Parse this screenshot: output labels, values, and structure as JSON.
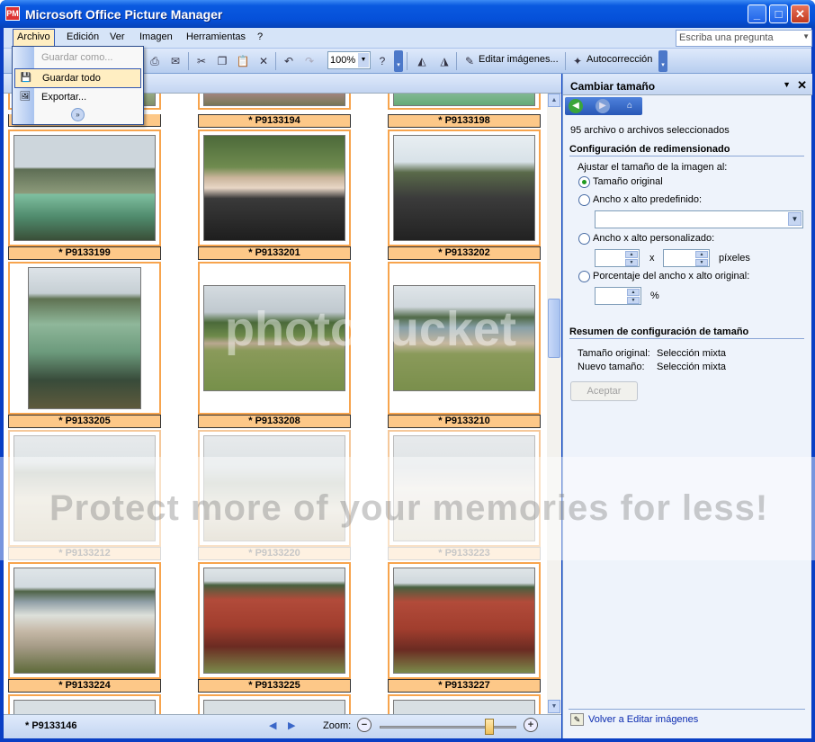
{
  "window": {
    "title": "Microsoft Office Picture Manager",
    "minimize": "_",
    "maximize": "□",
    "close": "✕",
    "app_icon": "PM"
  },
  "menubar": {
    "items": [
      "Archivo",
      "Edición",
      "Ver",
      "Imagen",
      "Herramientas",
      "?"
    ],
    "ask_placeholder": "Escriba una pregunta"
  },
  "file_menu": {
    "items": [
      {
        "label": "Guardar como...",
        "state": "disabled",
        "icon": "save-as-icon"
      },
      {
        "label": "Guardar todo",
        "state": "hover",
        "icon": "save-all-icon"
      },
      {
        "label": "Exportar...",
        "state": "normal",
        "icon": "export-icon"
      }
    ],
    "more_icon": "chevron-double-down-icon"
  },
  "toolbar": {
    "zoom_value": "100%",
    "edit_images_label": "Editar imágenes...",
    "autocorrect_label": "Autocorrección"
  },
  "thumbnails": [
    {
      "name": "* P9133199",
      "faded": false
    },
    {
      "name": "* P9133201",
      "faded": false
    },
    {
      "name": "* P9133202",
      "faded": false
    },
    {
      "name": "* P9133205",
      "faded": false
    },
    {
      "name": "* P9133208",
      "faded": false
    },
    {
      "name": "* P9133210",
      "faded": false
    },
    {
      "name": "* P9133212",
      "faded": true
    },
    {
      "name": "* P9133220",
      "faded": true
    },
    {
      "name": "* P9133223",
      "faded": true
    },
    {
      "name": "* P9133224",
      "faded": false
    },
    {
      "name": "* P9133225",
      "faded": false
    },
    {
      "name": "* P9133227",
      "faded": false
    }
  ],
  "top_row_captions": [
    "* P9133194",
    "* P9133198"
  ],
  "statusbar": {
    "current_file": "* P9133146",
    "zoom_label": "Zoom:",
    "prev": "◀",
    "next": "▶"
  },
  "pane": {
    "title": "Cambiar tamaño",
    "count_text": "95 archivo o archivos seleccionados",
    "section1": "Configuración de redimensionado",
    "adjust_label": "Ajustar el tamaño de la imagen al:",
    "options": [
      "Tamaño original",
      "Ancho x alto predefinido:",
      "Ancho x alto personalizado:",
      "Porcentaje del ancho x alto original:"
    ],
    "selected_option": 0,
    "x_label": "x",
    "pixels_label": "píxeles",
    "percent_label": "%",
    "section2": "Resumen de configuración de tamaño",
    "original_size_label": "Tamaño original:",
    "original_size_value": "Selección mixta",
    "new_size_label": "Nuevo tamaño:",
    "new_size_value": "Selección mixta",
    "accept_label": "Aceptar",
    "back_link": "Volver a Editar imágenes"
  },
  "watermark": {
    "text": "Protect more of your memories for less!",
    "logo": "photobucket"
  }
}
